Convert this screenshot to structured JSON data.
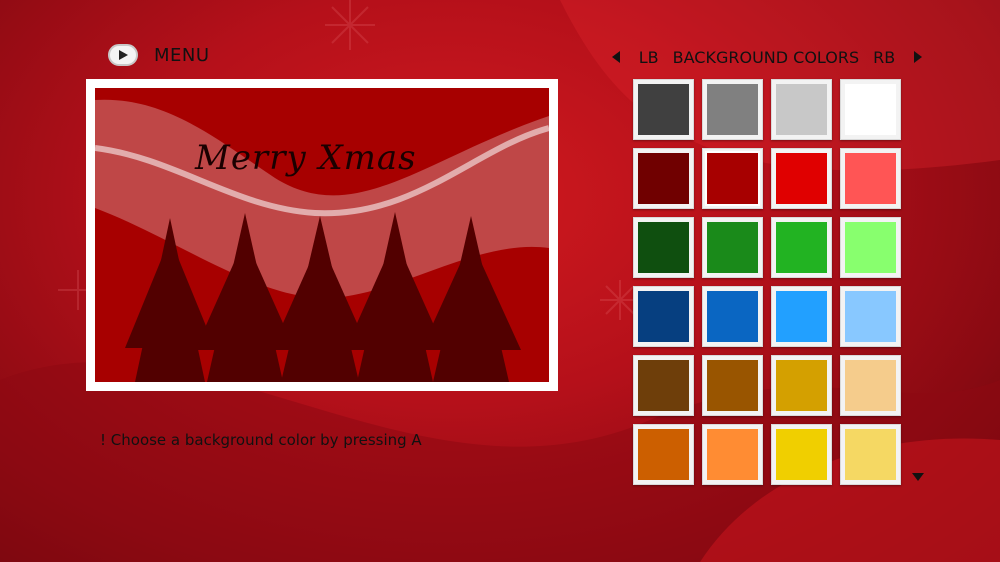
{
  "menu": {
    "label": "MENU"
  },
  "card": {
    "greeting": "Merry Xmas"
  },
  "hint": "! Choose a background color by pressing A",
  "palette": {
    "left_bumper": "LB",
    "title": "BACKGROUND COLORS",
    "right_bumper": "RB",
    "selected_index": 5,
    "colors": [
      "#404040",
      "#808080",
      "#c8c8c8",
      "#ffffff",
      "#700000",
      "#a70000",
      "#e00000",
      "#ff5555",
      "#0f4f0f",
      "#1a8a1a",
      "#22b322",
      "#88ff6e",
      "#063f80",
      "#0a66c2",
      "#22a0ff",
      "#88c8ff",
      "#6e3e0a",
      "#995500",
      "#d4a000",
      "#f5cc8c",
      "#cc5f00",
      "#ff8c33",
      "#f0cf00",
      "#f5d863"
    ]
  }
}
